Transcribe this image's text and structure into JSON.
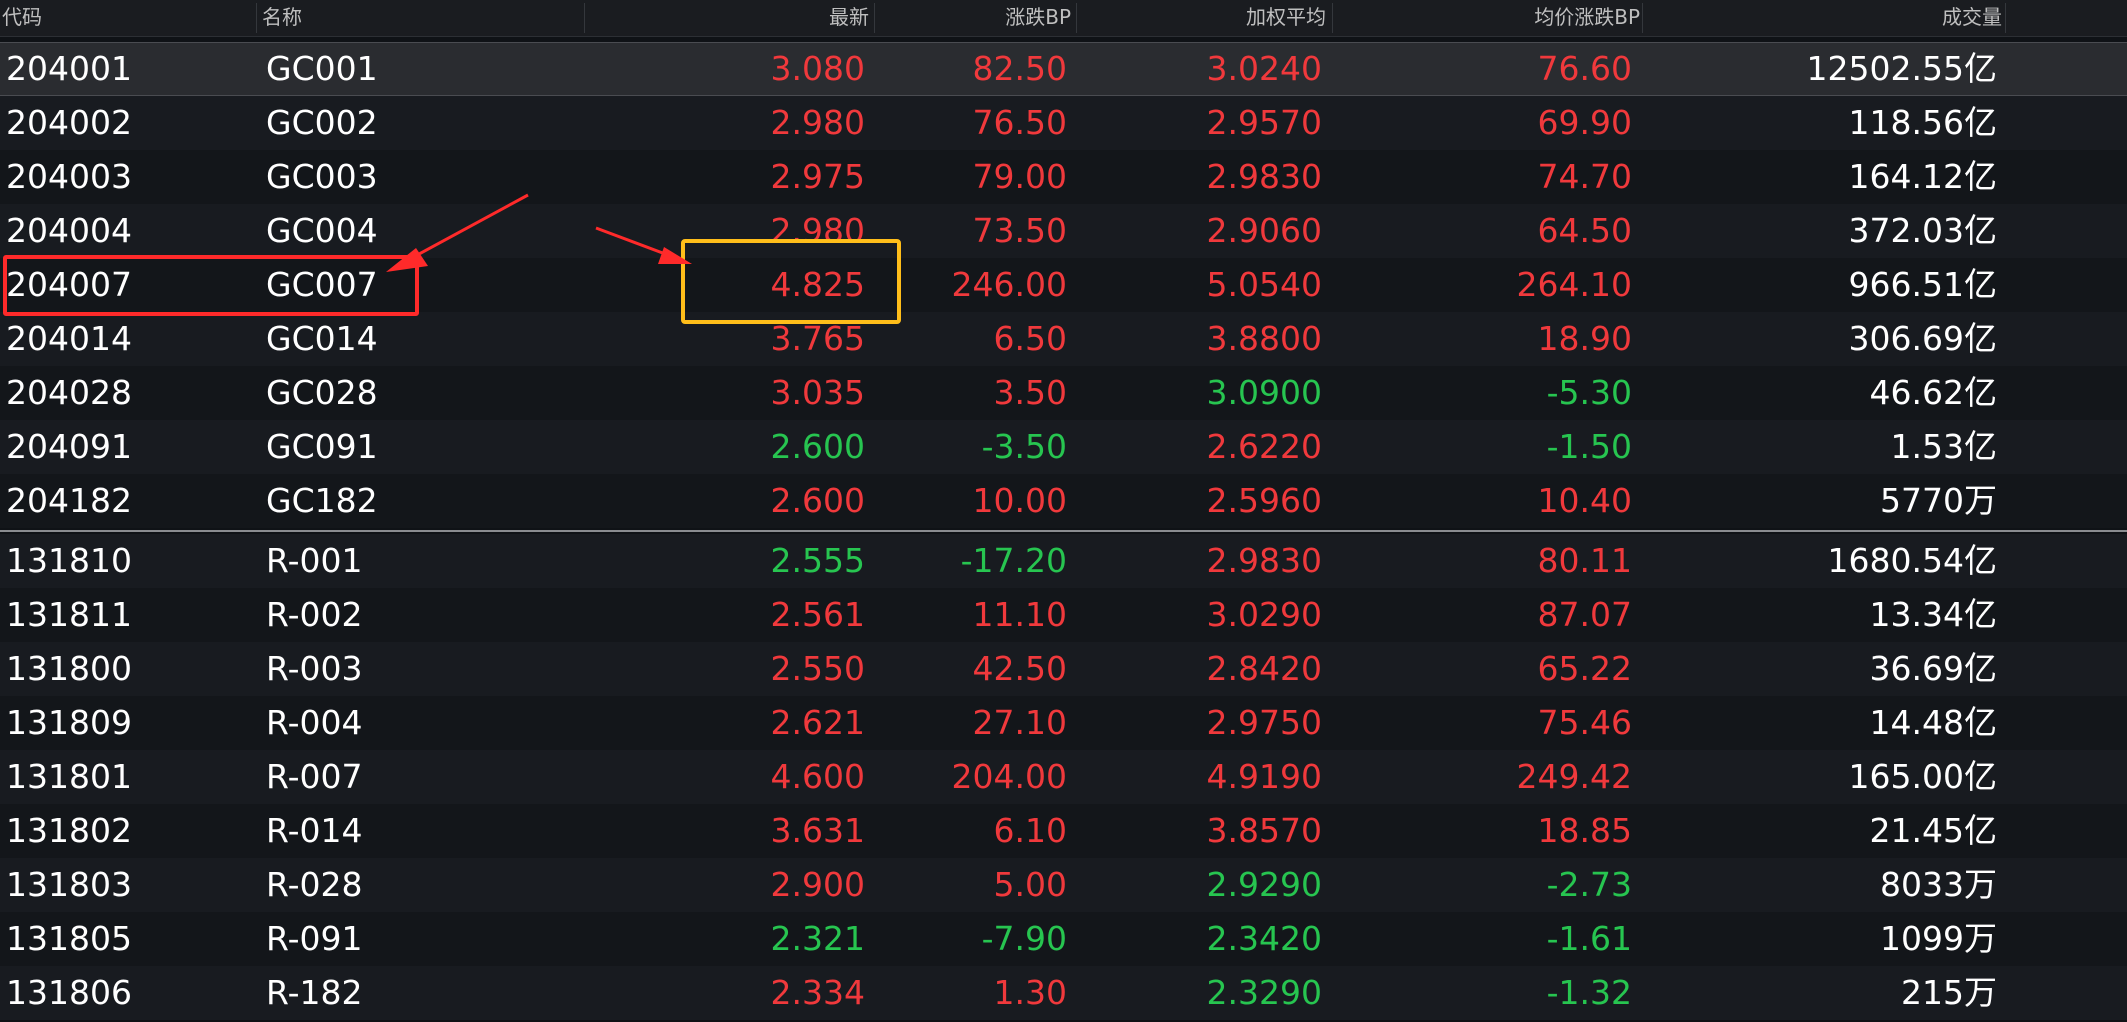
{
  "header": {
    "code": "代码",
    "name": "名称",
    "latest": "最新",
    "change_bp": "涨跌BP",
    "weighted_avg": "加权平均",
    "avg_change_bp": "均价涨跌BP",
    "volume": "成交量"
  },
  "rows": [
    {
      "code": "204001",
      "name": "GC001",
      "latest": "3.080",
      "change_bp": "82.50",
      "weighted_avg": "3.0240",
      "avg_change_bp": "76.60",
      "volume": "12502.55亿"
    },
    {
      "code": "204002",
      "name": "GC002",
      "latest": "2.980",
      "change_bp": "76.50",
      "weighted_avg": "2.9570",
      "avg_change_bp": "69.90",
      "volume": "118.56亿"
    },
    {
      "code": "204003",
      "name": "GC003",
      "latest": "2.975",
      "change_bp": "79.00",
      "weighted_avg": "2.9830",
      "avg_change_bp": "74.70",
      "volume": "164.12亿"
    },
    {
      "code": "204004",
      "name": "GC004",
      "latest": "2.980",
      "change_bp": "73.50",
      "weighted_avg": "2.9060",
      "avg_change_bp": "64.50",
      "volume": "372.03亿"
    },
    {
      "code": "204007",
      "name": "GC007",
      "latest": "4.825",
      "change_bp": "246.00",
      "weighted_avg": "5.0540",
      "avg_change_bp": "264.10",
      "volume": "966.51亿"
    },
    {
      "code": "204014",
      "name": "GC014",
      "latest": "3.765",
      "change_bp": "6.50",
      "weighted_avg": "3.8800",
      "avg_change_bp": "18.90",
      "volume": "306.69亿"
    },
    {
      "code": "204028",
      "name": "GC028",
      "latest": "3.035",
      "change_bp": "3.50",
      "weighted_avg": "3.0900",
      "avg_change_bp": "-5.30",
      "volume": "46.62亿"
    },
    {
      "code": "204091",
      "name": "GC091",
      "latest": "2.600",
      "change_bp": "-3.50",
      "weighted_avg": "2.6220",
      "avg_change_bp": "-1.50",
      "volume": "1.53亿"
    },
    {
      "code": "204182",
      "name": "GC182",
      "latest": "2.600",
      "change_bp": "10.00",
      "weighted_avg": "2.5960",
      "avg_change_bp": "10.40",
      "volume": "5770万"
    },
    {
      "code": "131810",
      "name": "R-001",
      "latest": "2.555",
      "change_bp": "-17.20",
      "weighted_avg": "2.9830",
      "avg_change_bp": "80.11",
      "volume": "1680.54亿"
    },
    {
      "code": "131811",
      "name": "R-002",
      "latest": "2.561",
      "change_bp": "11.10",
      "weighted_avg": "3.0290",
      "avg_change_bp": "87.07",
      "volume": "13.34亿"
    },
    {
      "code": "131800",
      "name": "R-003",
      "latest": "2.550",
      "change_bp": "42.50",
      "weighted_avg": "2.8420",
      "avg_change_bp": "65.22",
      "volume": "36.69亿"
    },
    {
      "code": "131809",
      "name": "R-004",
      "latest": "2.621",
      "change_bp": "27.10",
      "weighted_avg": "2.9750",
      "avg_change_bp": "75.46",
      "volume": "14.48亿"
    },
    {
      "code": "131801",
      "name": "R-007",
      "latest": "4.600",
      "change_bp": "204.00",
      "weighted_avg": "4.9190",
      "avg_change_bp": "249.42",
      "volume": "165.00亿"
    },
    {
      "code": "131802",
      "name": "R-014",
      "latest": "3.631",
      "change_bp": "6.10",
      "weighted_avg": "3.8570",
      "avg_change_bp": "18.85",
      "volume": "21.45亿"
    },
    {
      "code": "131803",
      "name": "R-028",
      "latest": "2.900",
      "change_bp": "5.00",
      "weighted_avg": "2.9290",
      "avg_change_bp": "-2.73",
      "volume": "8033万"
    },
    {
      "code": "131805",
      "name": "R-091",
      "latest": "2.321",
      "change_bp": "-7.90",
      "weighted_avg": "2.3420",
      "avg_change_bp": "-1.61",
      "volume": "1099万"
    },
    {
      "code": "131806",
      "name": "R-182",
      "latest": "2.334",
      "change_bp": "1.30",
      "weighted_avg": "2.3290",
      "avg_change_bp": "-1.32",
      "volume": "215万"
    }
  ],
  "colors": {
    "up": "#f0393c",
    "down": "#27c550",
    "highlight_red": "#ff2a2a",
    "highlight_yellow": "#ffbe1a"
  }
}
